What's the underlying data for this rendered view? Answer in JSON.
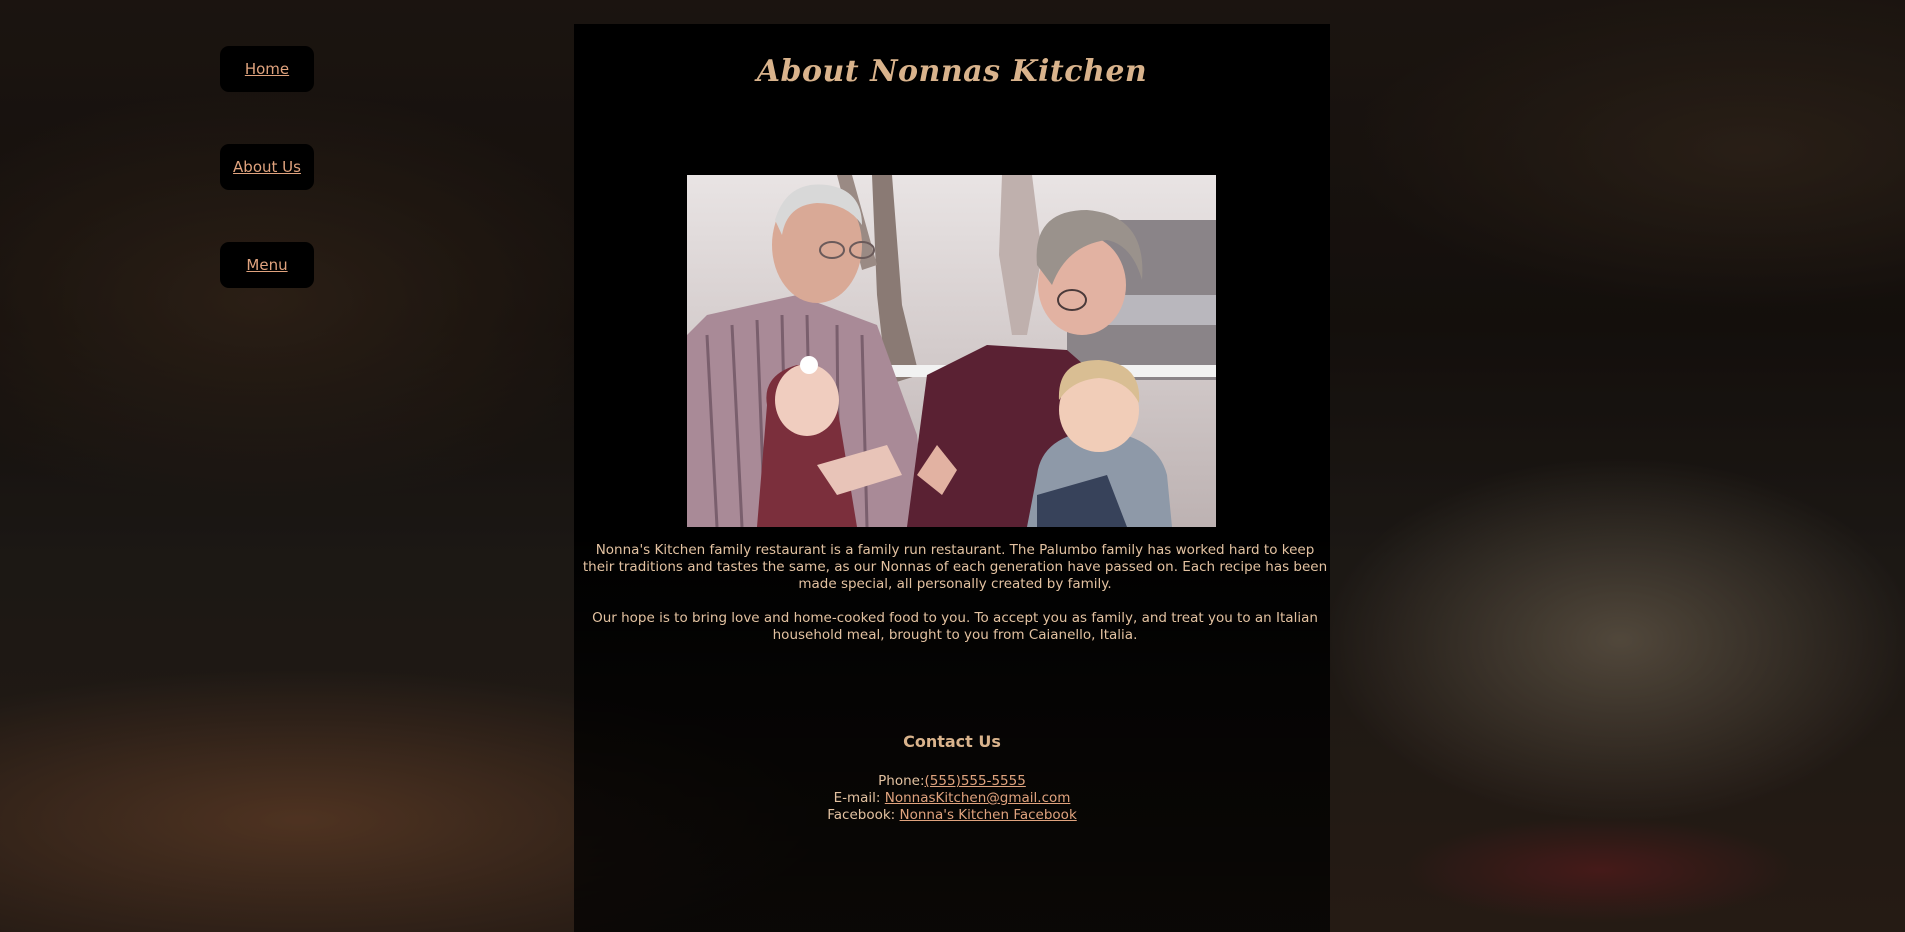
{
  "nav": {
    "items": [
      {
        "label": "Home"
      },
      {
        "label": "About Us"
      },
      {
        "label": "Menu"
      }
    ]
  },
  "main": {
    "title": "About Nonnas Kitchen",
    "paragraphs": [
      "Nonna's Kitchen family restaurant is a family run restaurant. The Palumbo family has worked hard to keep their traditions and tastes the same, as our Nonnas of each generation have passed on. Each recipe has been made special, all personally created by family.",
      "Our hope is to bring love and home-cooked food to you. To accept you as family, and treat you to an Italian household meal, brought to you from Caianello, Italia."
    ]
  },
  "contact": {
    "heading": "Contact Us",
    "phone_label": "Phone:",
    "phone_value": "(555)555-5555",
    "email_label": "E-mail:",
    "email_value": "NonnasKitchen@gmail.com",
    "facebook_label": "Facebook:",
    "facebook_value": "Nonna's Kitchen Facebook"
  },
  "colors": {
    "accent": "#e0a37e",
    "text": "#e3c2a1",
    "panel": "#000000"
  }
}
